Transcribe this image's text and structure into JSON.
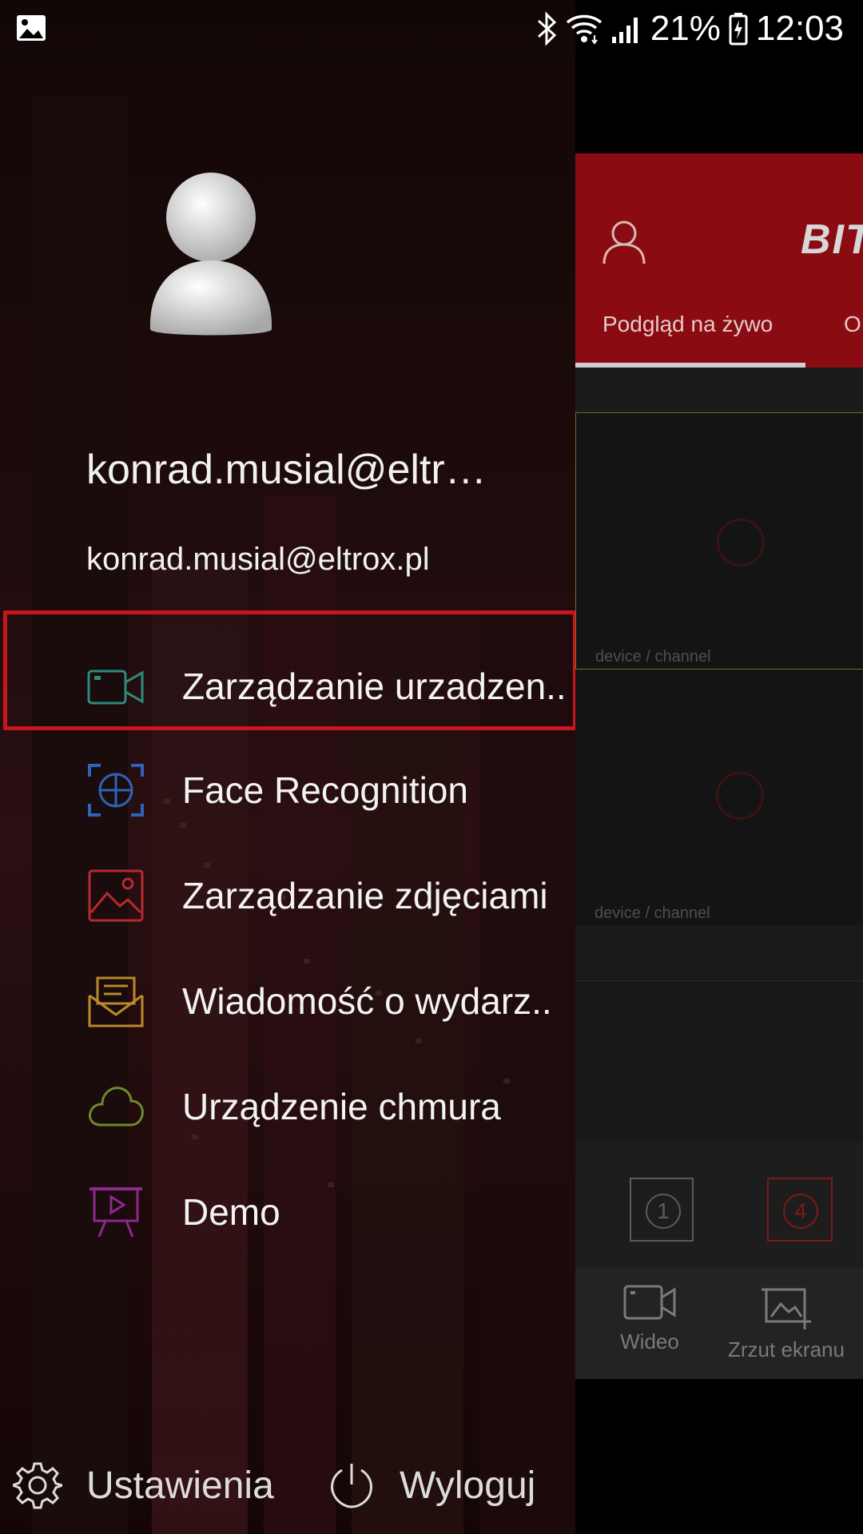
{
  "status_bar": {
    "battery": "21%",
    "time": "12:03",
    "icons": [
      "gallery-icon",
      "bluetooth-icon",
      "wifi-icon",
      "signal-icon",
      "battery-charging-icon"
    ]
  },
  "drawer": {
    "user_name": "konrad.musial@eltr…",
    "user_email": "konrad.musial@eltrox.pl",
    "menu": [
      {
        "label": "Zarządzanie urzadzen..",
        "icon": "video-camera-icon",
        "color": "#2e8a7e"
      },
      {
        "label": "Face Recognition",
        "icon": "face-scan-icon",
        "color": "#2e63b8"
      },
      {
        "label": "Zarządzanie zdjęciami",
        "icon": "image-icon",
        "color": "#b62a30"
      },
      {
        "label": "Wiadomość o wydarz..",
        "icon": "envelope-icon",
        "color": "#b88a2a"
      },
      {
        "label": "Urządzenie chmura",
        "icon": "cloud-icon",
        "color": "#6a8a2a"
      },
      {
        "label": "Demo",
        "icon": "presentation-play-icon",
        "color": "#8a2a8a"
      }
    ],
    "footer": {
      "settings_label": "Ustawienia",
      "logout_label": "Wyloguj"
    }
  },
  "background_app": {
    "brand": "BIT",
    "tabs": [
      "Podgląd na żywo",
      "O"
    ],
    "channel_labels": [
      "device / channel",
      "device / channel"
    ],
    "layouts": [
      "1",
      "4"
    ],
    "bottom_actions": [
      "Wideo",
      "Zrzut ekranu"
    ],
    "accent_color": "#8a0c12"
  }
}
